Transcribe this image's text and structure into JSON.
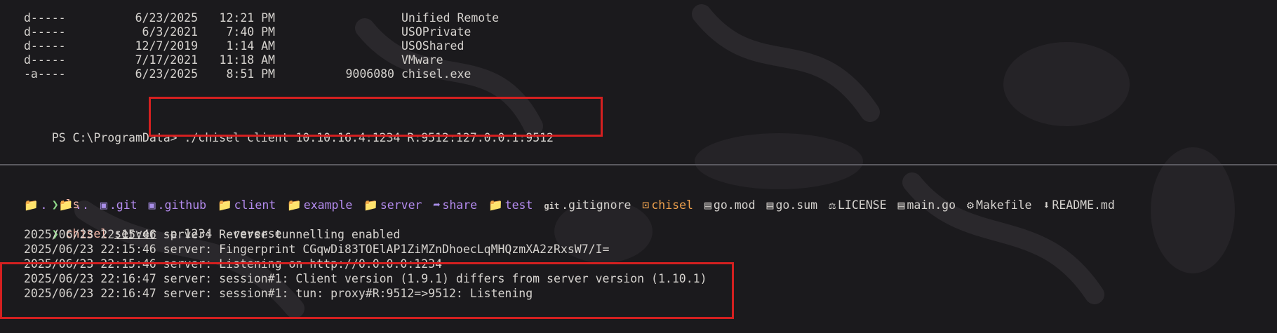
{
  "colors": {
    "background": "#1b1a1d",
    "highlight_box": "#d42020",
    "directory": "#b58cf0",
    "executable": "#f0a24e",
    "prompt_arrow": "#8fd98a",
    "command": "#f5b8a8"
  },
  "top_pane": {
    "rows": [
      {
        "mode": "d-----",
        "date": "6/23/2025",
        "time": "12:21 PM",
        "length": "",
        "name": "Unified Remote"
      },
      {
        "mode": "d-----",
        "date": "6/3/2021",
        "time": "7:40 PM",
        "length": "",
        "name": "USOPrivate"
      },
      {
        "mode": "d-----",
        "date": "12/7/2019",
        "time": "1:14 AM",
        "length": "",
        "name": "USOShared"
      },
      {
        "mode": "d-----",
        "date": "7/17/2021",
        "time": "11:18 AM",
        "length": "",
        "name": "VMware"
      },
      {
        "mode": "-a----",
        "date": "6/23/2025",
        "time": "8:51 PM",
        "length": "9006080",
        "name": "chisel.exe"
      }
    ],
    "prompt": "PS C:\\ProgramData>",
    "command": " ./chisel client 10.10.16.4:1234 R:9512:127.0.0.1:9512"
  },
  "bottom_pane": {
    "prompt_arrow": "❯",
    "ls_command": "ls",
    "ls_items": [
      {
        "name": ".",
        "icon": "folder-icon",
        "kind": "dir",
        "glyph": "📁"
      },
      {
        "name": "..",
        "icon": "folder-icon",
        "kind": "dir",
        "glyph": "📁"
      },
      {
        "name": ".git",
        "icon": "git-folder-icon",
        "kind": "dir",
        "glyph": "▣"
      },
      {
        "name": ".github",
        "icon": "github-folder-icon",
        "kind": "dir",
        "glyph": "▣"
      },
      {
        "name": "client",
        "icon": "folder-icon",
        "kind": "dir",
        "glyph": "📁"
      },
      {
        "name": "example",
        "icon": "folder-icon",
        "kind": "dir",
        "glyph": "📁"
      },
      {
        "name": "server",
        "icon": "folder-icon",
        "kind": "dir",
        "glyph": "📁"
      },
      {
        "name": "share",
        "icon": "share-icon",
        "kind": "dir",
        "glyph": "➦"
      },
      {
        "name": "test",
        "icon": "folder-icon",
        "kind": "dir",
        "glyph": "📁"
      },
      {
        "name": ".gitignore",
        "icon": "git-icon",
        "kind": "file",
        "glyph": "git"
      },
      {
        "name": "chisel",
        "icon": "executable-icon",
        "kind": "exe",
        "glyph": "⊡"
      },
      {
        "name": "go.mod",
        "icon": "go-file-icon",
        "kind": "file",
        "glyph": "▤"
      },
      {
        "name": "go.sum",
        "icon": "go-file-icon",
        "kind": "file",
        "glyph": "▤"
      },
      {
        "name": "LICENSE",
        "icon": "license-icon",
        "kind": "file",
        "glyph": "⚖"
      },
      {
        "name": "main.go",
        "icon": "go-file-icon",
        "kind": "file",
        "glyph": "▤"
      },
      {
        "name": "Makefile",
        "icon": "gear-icon",
        "kind": "file",
        "glyph": "⚙"
      },
      {
        "name": "README.md",
        "icon": "markdown-icon",
        "kind": "file",
        "glyph": "⬇"
      }
    ],
    "server_cmd": "chisel",
    "server_sub": "server",
    "server_args": " -p 1234 --reverse",
    "log": [
      "2025/06/23 22:15:46 server: Reverse tunnelling enabled",
      "2025/06/23 22:15:46 server: Fingerprint CGqwDi83TOElAP1ZiMZnDhoecLqMHQzmXA2zRxsW7/I=",
      "2025/06/23 22:15:46 server: Listening on http://0.0.0.0:1234",
      "2025/06/23 22:16:47 server: session#1: Client version (1.9.1) differs from server version (1.10.1)",
      "2025/06/23 22:16:47 server: session#1: tun: proxy#R:9512=>9512: Listening"
    ]
  }
}
